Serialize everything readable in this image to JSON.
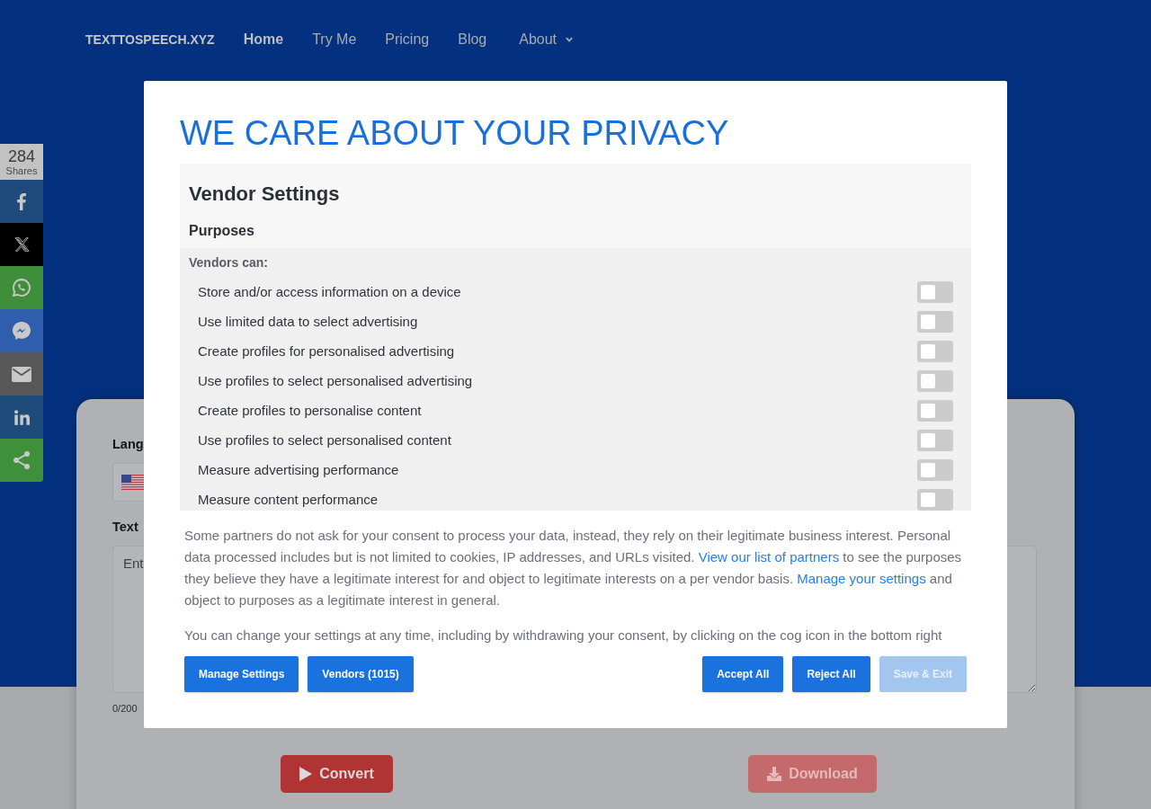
{
  "nav": {
    "logo": "TEXTTOSPEECH.XYZ",
    "items": [
      {
        "label": "Home",
        "kind": "link",
        "selected": true
      },
      {
        "label": "Try Me",
        "kind": "link",
        "selected": false
      },
      {
        "label": "Pricing",
        "kind": "link",
        "selected": false
      },
      {
        "label": "Blog",
        "kind": "link",
        "selected": false
      },
      {
        "label": "About",
        "kind": "dropdown",
        "selected": false
      }
    ]
  },
  "share_bar": {
    "count": "284",
    "count_label": "Shares",
    "buttons": [
      {
        "kind": "facebook",
        "color": "#1e4a7c"
      },
      {
        "kind": "x",
        "color": "#000000"
      },
      {
        "kind": "whatsapp",
        "color": "#3f8f3a"
      },
      {
        "kind": "messenger",
        "color": "#2f5eac"
      },
      {
        "kind": "email",
        "color": "#575757"
      },
      {
        "kind": "linkedin",
        "color": "#1d4b7a"
      },
      {
        "kind": "share",
        "color": "#3f8f3b"
      }
    ]
  },
  "converter": {
    "language_label": "Lang",
    "text_label": "Text",
    "text_input": {
      "placeholder": "Ent"
    },
    "char_count": "0/200",
    "convert_button": {
      "label": "Convert",
      "disabled": false
    },
    "download_button": {
      "label": "Download",
      "disabled": true
    }
  },
  "consent_dialog": {
    "title": "WE CARE ABOUT YOUR PRIVACY",
    "vendor_settings": {
      "heading": "Vendor Settings",
      "subheading": "Purposes",
      "list_label": "Vendors can:",
      "purposes": [
        {
          "label": "Store and/or access information on a device",
          "on": false
        },
        {
          "label": "Use limited data to select advertising",
          "on": false
        },
        {
          "label": "Create profiles for personalised advertising",
          "on": false
        },
        {
          "label": "Use profiles to select personalised advertising",
          "on": false
        },
        {
          "label": "Create profiles to personalise content",
          "on": false
        },
        {
          "label": "Use profiles to select personalised content",
          "on": false
        },
        {
          "label": "Measure advertising performance",
          "on": false
        },
        {
          "label": "Measure content performance",
          "on": false
        }
      ]
    },
    "paragraphs": [
      [
        {
          "kind": "text",
          "text": "Some partners do not ask for your consent to process your data, instead, they rely on their legitimate business interest. Personal data processed includes but is not limited to cookies, IP addresses, and URLs visited. "
        },
        {
          "kind": "link",
          "text": "View our list of partners"
        },
        {
          "kind": "text",
          "text": " to see the purposes they believe they have a legitimate interest for and object to legitimate interests on a per vendor basis. "
        },
        {
          "kind": "link",
          "text": "Manage your settings"
        },
        {
          "kind": "text",
          "text": " and object to purposes as a legitimate interest in general."
        }
      ],
      [
        {
          "kind": "text",
          "text": "You can change your settings at any time, including by withdrawing your consent, by clicking on the cog icon in the bottom right"
        }
      ]
    ],
    "left_buttons": [
      {
        "label": "Manage Settings",
        "disabled": false
      },
      {
        "label": "Vendors (1015)",
        "disabled": false
      }
    ],
    "right_buttons": [
      {
        "label": "Accept All",
        "disabled": false
      },
      {
        "label": "Reject All",
        "disabled": false
      },
      {
        "label": "Save & Exit",
        "disabled": true
      }
    ]
  }
}
